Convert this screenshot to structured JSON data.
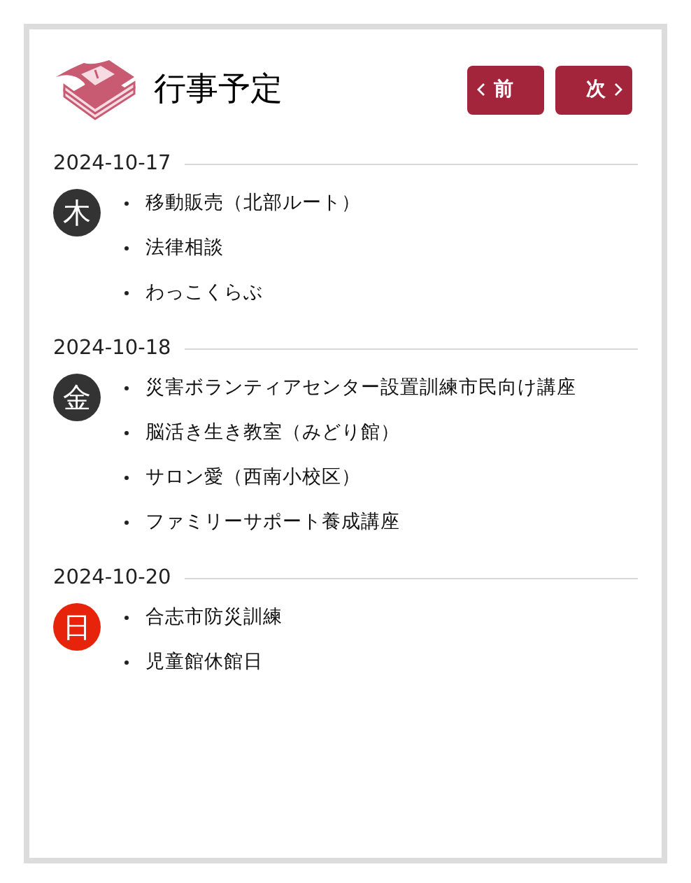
{
  "title": "行事予定",
  "nav": [
    {
      "label": "前",
      "kind": "prev"
    },
    {
      "label": "次",
      "kind": "next"
    }
  ],
  "days": [
    {
      "date": "2024-10-17",
      "weekday": "木",
      "color": "#333333",
      "events": [
        "移動販売（北部ルート）",
        "法律相談",
        "わっこくらぶ"
      ]
    },
    {
      "date": "2024-10-18",
      "weekday": "金",
      "color": "#333333",
      "events": [
        "災害ボランティアセンター設置訓練市民向け講座",
        "脳活き生き教室（みどり館）",
        "サロン愛（西南小校区）",
        "ファミリーサポート養成講座"
      ]
    },
    {
      "date": "2024-10-20",
      "weekday": "日",
      "color": "#e8230b",
      "events": [
        "合志市防災訓練",
        "児童館休館日"
      ]
    }
  ]
}
